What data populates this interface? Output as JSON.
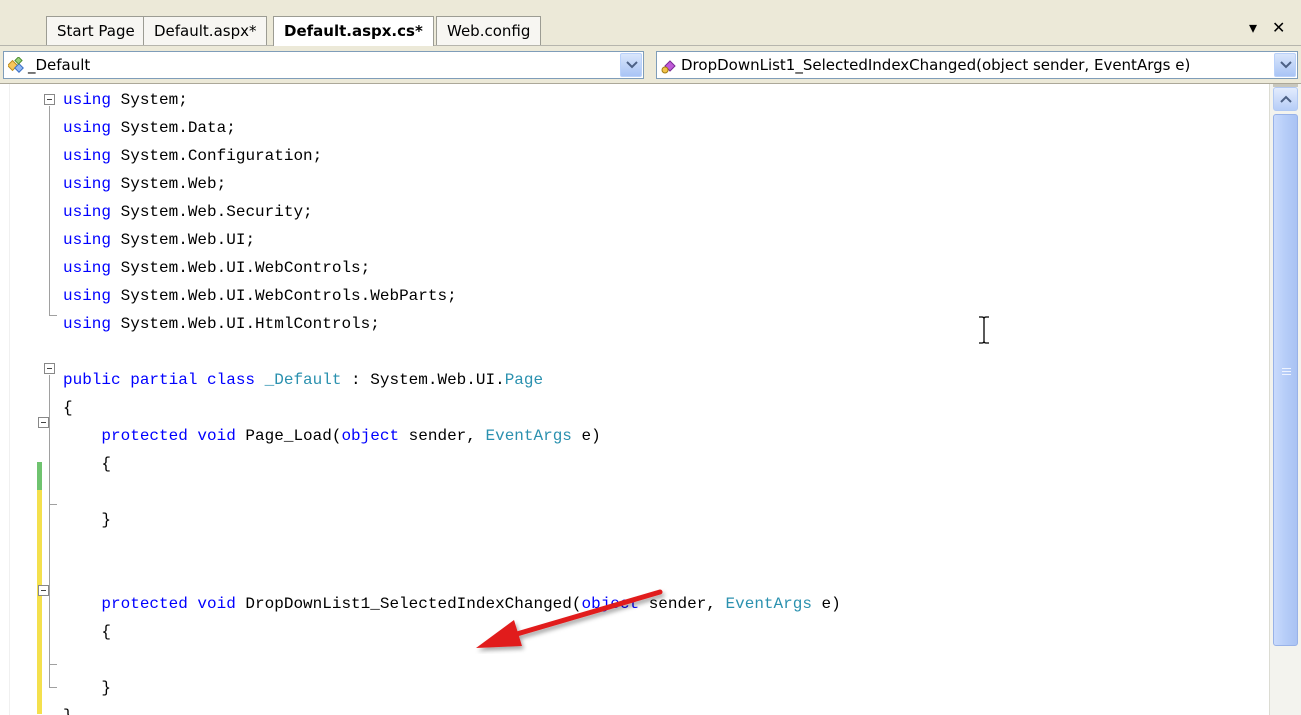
{
  "tabs": [
    {
      "label": "Start Page",
      "active": false
    },
    {
      "label": "Default.aspx*",
      "active": false
    },
    {
      "label": "Default.aspx.cs*",
      "active": true
    },
    {
      "label": "Web.config",
      "active": false
    }
  ],
  "strip_buttons": {
    "dropdown": "▾",
    "close": "✕"
  },
  "navbar": {
    "type_combo": "_Default",
    "member_combo": "DropDownList1_SelectedIndexChanged(object sender, EventArgs e)"
  },
  "code_lines": [
    [
      {
        "t": "using",
        "c": "kw"
      },
      {
        "t": " System;"
      }
    ],
    [
      {
        "t": "using",
        "c": "kw"
      },
      {
        "t": " System.Data;"
      }
    ],
    [
      {
        "t": "using",
        "c": "kw"
      },
      {
        "t": " System.Configuration;"
      }
    ],
    [
      {
        "t": "using",
        "c": "kw"
      },
      {
        "t": " System.Web;"
      }
    ],
    [
      {
        "t": "using",
        "c": "kw"
      },
      {
        "t": " System.Web.Security;"
      }
    ],
    [
      {
        "t": "using",
        "c": "kw"
      },
      {
        "t": " System.Web.UI;"
      }
    ],
    [
      {
        "t": "using",
        "c": "kw"
      },
      {
        "t": " System.Web.UI.WebControls;"
      }
    ],
    [
      {
        "t": "using",
        "c": "kw"
      },
      {
        "t": " System.Web.UI.WebControls.WebParts;"
      }
    ],
    [
      {
        "t": "using",
        "c": "kw"
      },
      {
        "t": " System.Web.UI.HtmlControls;"
      }
    ],
    [],
    [
      {
        "t": "public partial class",
        "c": "kw"
      },
      {
        "t": " "
      },
      {
        "t": "_Default",
        "c": "ty"
      },
      {
        "t": " : System.Web.UI."
      },
      {
        "t": "Page",
        "c": "ty"
      }
    ],
    [
      {
        "t": "{"
      }
    ],
    [
      {
        "t": "    "
      },
      {
        "t": "protected void",
        "c": "kw"
      },
      {
        "t": " Page_Load("
      },
      {
        "t": "object",
        "c": "kw"
      },
      {
        "t": " sender, "
      },
      {
        "t": "EventArgs",
        "c": "ty"
      },
      {
        "t": " e)"
      }
    ],
    [
      {
        "t": "    {"
      }
    ],
    [],
    [
      {
        "t": "    }"
      }
    ],
    [],
    [],
    [
      {
        "t": "    "
      },
      {
        "t": "protected void",
        "c": "kw"
      },
      {
        "t": " DropDownList1_SelectedIndexChanged("
      },
      {
        "t": "object",
        "c": "kw"
      },
      {
        "t": " sender, "
      },
      {
        "t": "EventArgs",
        "c": "ty"
      },
      {
        "t": " e)"
      }
    ],
    [
      {
        "t": "    {"
      }
    ],
    [],
    [
      {
        "t": "    }"
      }
    ],
    [
      {
        "t": "}"
      }
    ]
  ],
  "colors": {
    "keyword": "#0000ff",
    "type": "#2b91af",
    "saved_change": "#6fc36f",
    "unsaved_change": "#f4e04d",
    "annotation_arrow": "#e11d1d"
  },
  "icons": {
    "type_combo": "class-icon",
    "member_combo": "method-icon",
    "annotation": "red-arrow-icon",
    "cursor": "ibeam-cursor-icon"
  }
}
